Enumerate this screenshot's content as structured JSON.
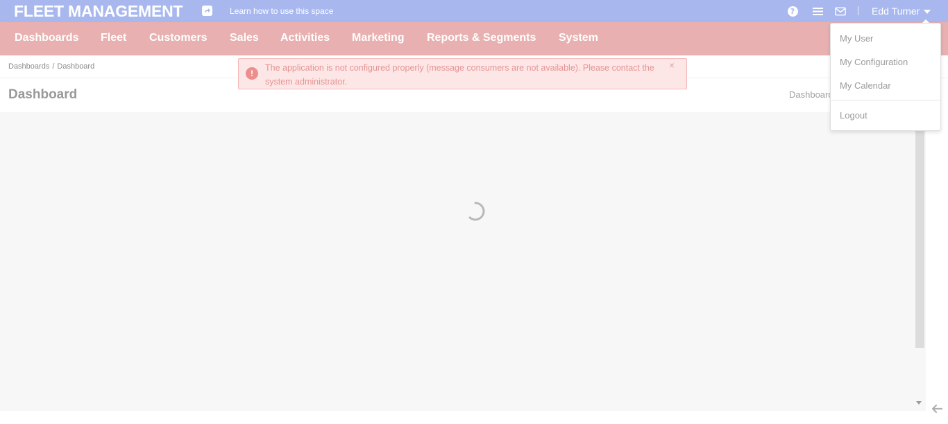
{
  "topbar": {
    "app_title": "FLEET MANAGEMENT",
    "learn_link": "Learn how to use this space",
    "help_symbol": "?",
    "user_name": "Edd Turner"
  },
  "navbar": {
    "items": [
      "Dashboards",
      "Fleet",
      "Customers",
      "Sales",
      "Activities",
      "Marketing",
      "Reports & Segments",
      "System"
    ]
  },
  "breadcrumb": {
    "items": [
      "Dashboards",
      "Dashboard"
    ],
    "separator": "/"
  },
  "page": {
    "title": "Dashboard",
    "dashboard_selector": "Dashboard"
  },
  "alert": {
    "icon_symbol": "!",
    "message": "The application is not configured properly (message consumers are not available). Please contact the system administrator.",
    "close_symbol": "×"
  },
  "user_dropdown": {
    "items": [
      "My User",
      "My Configuration",
      "My Calendar"
    ],
    "logout": "Logout"
  },
  "colors": {
    "topbar_bg": "#a8b8ee",
    "navbar_bg": "#e8b0b0",
    "alert_bg": "#fde6e6",
    "alert_text": "#e69494"
  },
  "icons": [
    "share-icon",
    "help-icon",
    "menu-icon",
    "mail-icon",
    "chevron-down-icon",
    "error-icon",
    "close-icon",
    "spinner-icon",
    "back-arrow-icon"
  ]
}
